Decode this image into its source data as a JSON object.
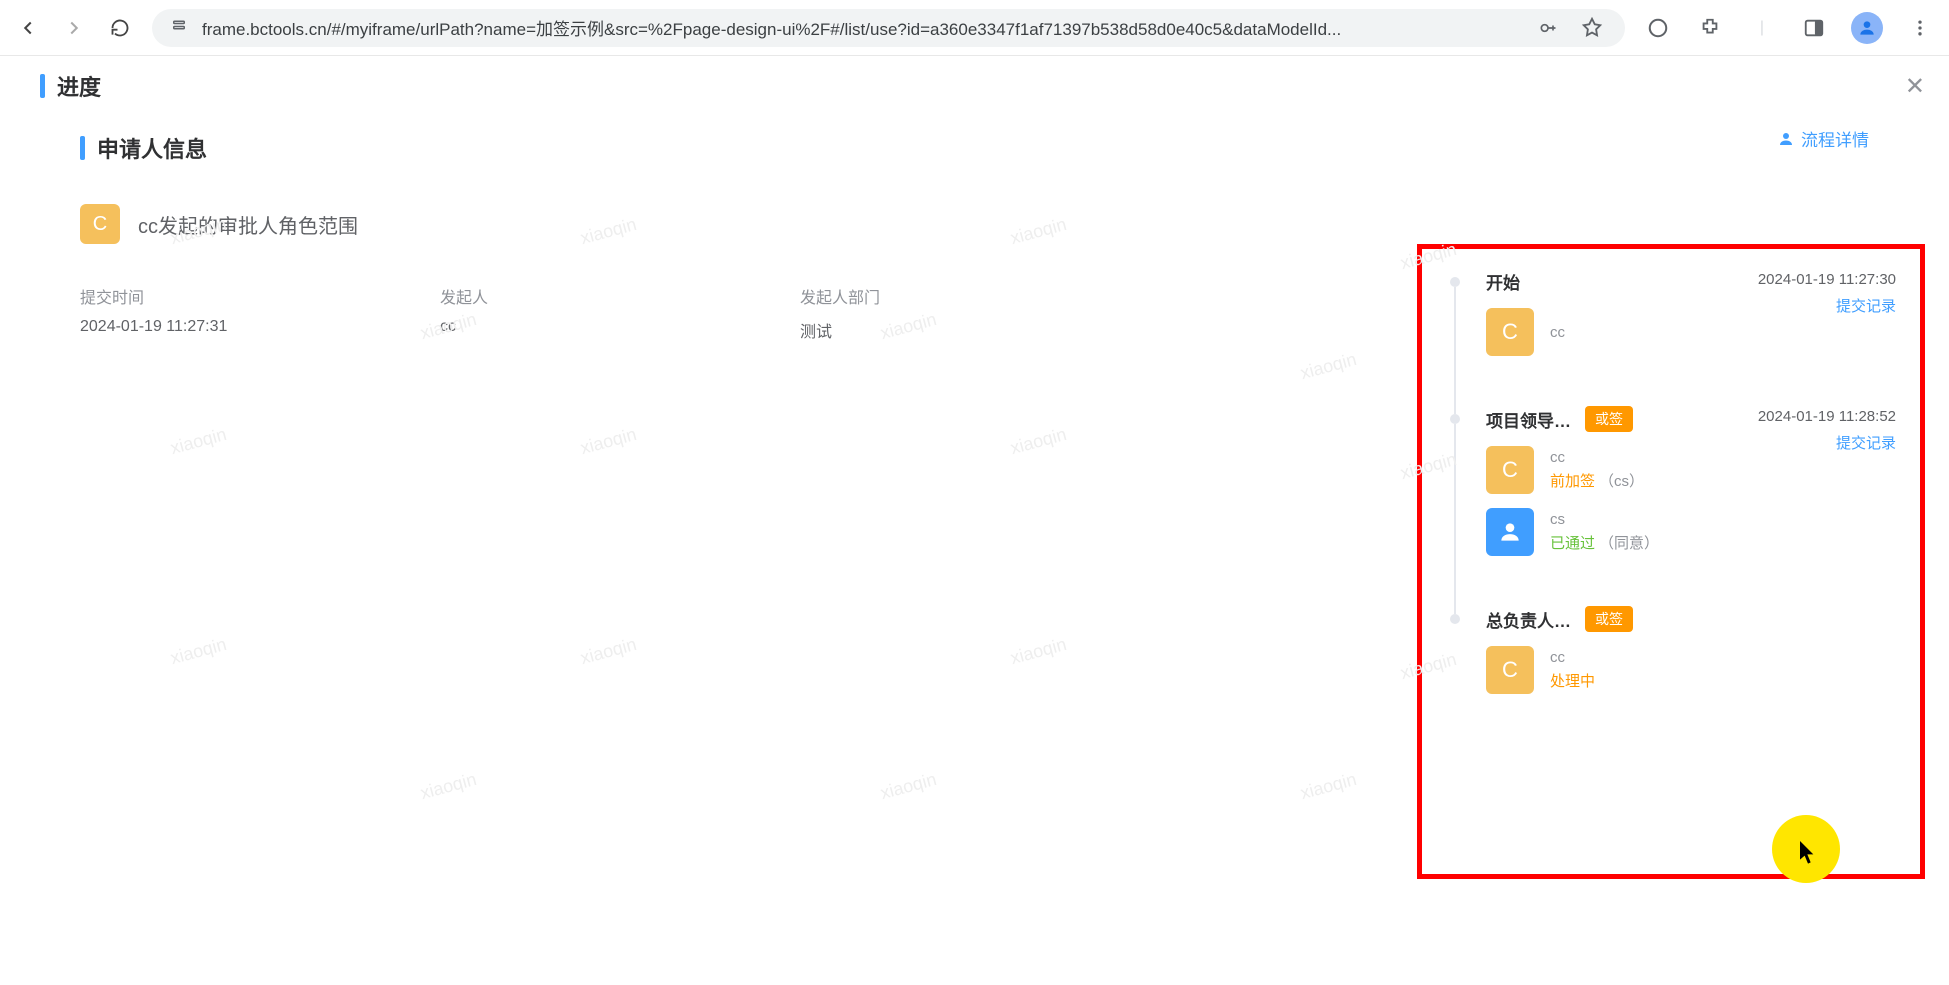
{
  "browser": {
    "url": "frame.bctools.cn/#/myiframe/urlPath?name=加签示例&src=%2Fpage-design-ui%2F#/list/use?id=a360e3347f1af71397b538d58d0e40c5&dataModelId..."
  },
  "page": {
    "title": "进度",
    "section_title": "申请人信息",
    "flow_details_label": "流程详情",
    "applicant": {
      "initial": "C",
      "name": "cc发起的审批人角色范围"
    },
    "info": {
      "submit_time_label": "提交时间",
      "submit_time_value": "2024-01-19 11:27:31",
      "initiator_label": "发起人",
      "initiator_value": "cc",
      "initiator_dept_label": "发起人部门",
      "initiator_dept_value": "测试"
    }
  },
  "timeline": [
    {
      "title": "开始",
      "tag": "",
      "time": "2024-01-19 11:27:30",
      "link": "提交记录",
      "actors": [
        {
          "initial": "C",
          "avatar": "yellow",
          "name": "cc",
          "status": "",
          "status_class": "",
          "note": ""
        }
      ]
    },
    {
      "title": "项目领导…",
      "tag": "或签",
      "time": "2024-01-19 11:28:52",
      "link": "提交记录",
      "actors": [
        {
          "initial": "C",
          "avatar": "yellow",
          "name": "cc",
          "status": "前加签",
          "status_class": "status-orange",
          "note": "（cs）"
        },
        {
          "initial": "👤",
          "avatar": "blue",
          "name": "cs",
          "status": "已通过",
          "status_class": "status-green",
          "note": "（同意）"
        }
      ]
    },
    {
      "title": "总负责人…",
      "tag": "或签",
      "time": "",
      "link": "",
      "actors": [
        {
          "initial": "C",
          "avatar": "yellow",
          "name": "cc",
          "status": "处理中",
          "status_class": "status-orange",
          "note": ""
        }
      ]
    }
  ],
  "watermark_text": "xiaoqin"
}
